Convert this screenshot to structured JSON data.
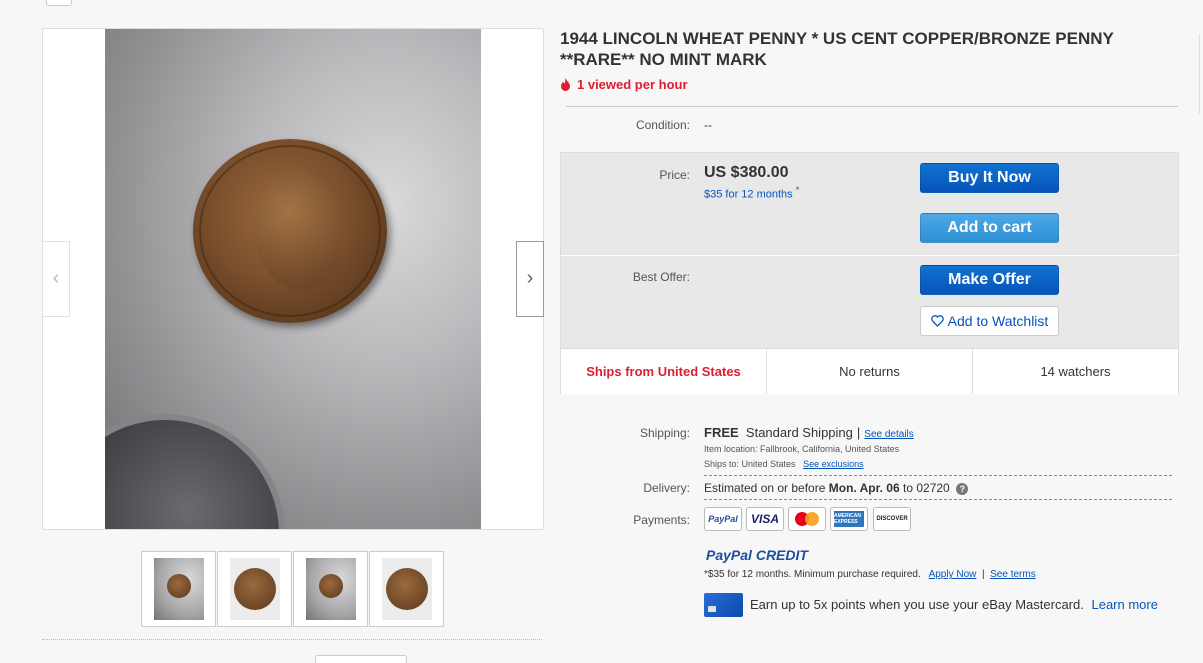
{
  "listing": {
    "title": "1944 LINCOLN WHEAT PENNY * US CENT COPPER/BRONZE PENNY **RARE** NO MINT MARK",
    "viewed": "1 viewed per hour",
    "condition_label": "Condition:",
    "condition_value": "--"
  },
  "buy": {
    "price_label": "Price:",
    "price": "US $380.00",
    "finance": "$35 for 12 months",
    "finance_mark": "*",
    "buy_now": "Buy It Now",
    "add_to_cart": "Add to cart",
    "best_offer_label": "Best Offer:",
    "make_offer": "Make Offer",
    "watchlist": "Add to Watchlist",
    "ships_from": "Ships from United States",
    "returns": "No returns",
    "watchers": "14 watchers"
  },
  "shipping": {
    "label": "Shipping:",
    "free": "FREE",
    "method": "Standard Shipping",
    "separator": "|",
    "see_details": "See details",
    "item_location": "Item location:  Fallbrook, California, United States",
    "ships_to": "Ships to:  United States",
    "see_exclusions": "See exclusions"
  },
  "delivery": {
    "label": "Delivery:",
    "prefix": "Estimated on or before",
    "date": "Mon. Apr. 06",
    "suffix": "to 02720",
    "help": "?"
  },
  "payments": {
    "label": "Payments:",
    "methods": [
      "PayPal",
      "VISA",
      "",
      "AMERICAN EXPRESS",
      "DISCOVER"
    ]
  },
  "paypal_credit": {
    "brand_a": "PayPal",
    "brand_b": "CREDIT",
    "note": "*$35 for 12 months. Minimum purchase required.",
    "apply_now": "Apply Now",
    "sep": "|",
    "see_terms": "See terms"
  },
  "mastercard": {
    "text": "Earn up to 5x points when you use your eBay Mastercard.",
    "learn_more": "Learn more"
  },
  "gallery": {
    "prev": "‹",
    "next": "›"
  }
}
